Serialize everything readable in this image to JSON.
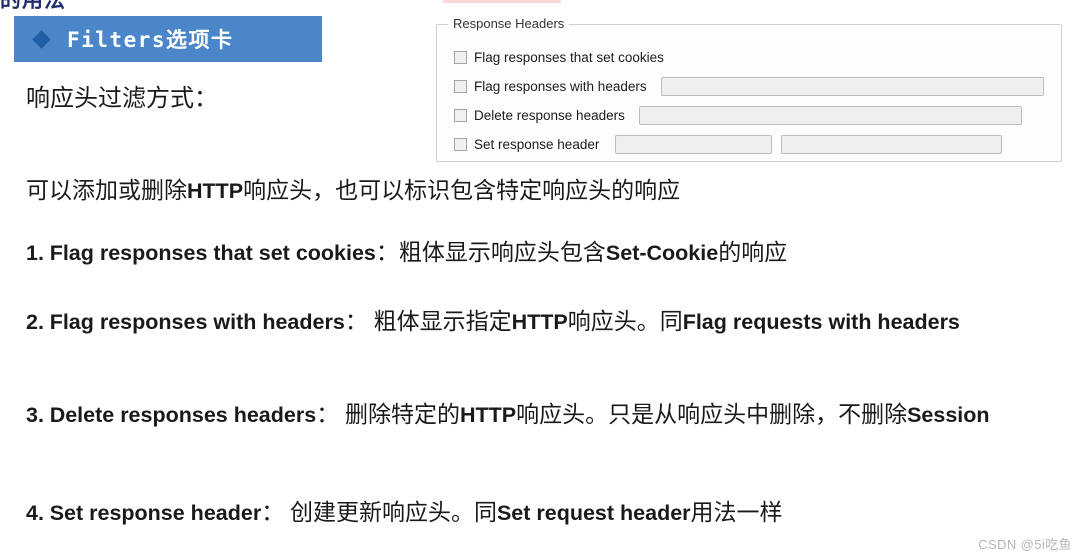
{
  "page": {
    "cutoff_title": "的用法",
    "watermark": "CSDN @5i吃鱼"
  },
  "banner": {
    "bullet_icon": "diamond-bullet-icon",
    "title": "Filters选项卡",
    "background_color": "#4a86c8",
    "bullet_color": "#1f5fa8",
    "text_color": "#ffffff"
  },
  "intro": {
    "text": "响应头过滤方式："
  },
  "fiddler_panel": {
    "groupbox_title": "Response Headers",
    "rows": [
      {
        "checkbox_label": "Flag responses that set cookies",
        "checked": false,
        "fields": []
      },
      {
        "checkbox_label": "Flag responses with headers",
        "checked": false,
        "fields": [
          {
            "value": "",
            "width": "wide"
          }
        ]
      },
      {
        "checkbox_label": "Delete response headers",
        "checked": false,
        "fields": [
          {
            "value": "",
            "width": "wide"
          }
        ]
      },
      {
        "checkbox_label": "Set response header",
        "checked": false,
        "fields": [
          {
            "value": "",
            "width": "half-a"
          },
          {
            "value": "",
            "width": "half-b"
          }
        ]
      }
    ]
  },
  "content": {
    "lead": {
      "part_a": "可以添加或删除",
      "latin_a": "HTTP",
      "part_b": "响应头，也可以标识包含特定响应头的响应"
    },
    "items": [
      {
        "number": "1.",
        "latin_title": "Flag responses that set cookies",
        "colon": "：",
        "cn_a": "粗体显示响应头包含",
        "latin_b": "Set-Cookie",
        "cn_b": "的响应"
      },
      {
        "number": "2.",
        "latin_title": "Flag responses with headers",
        "colon": "：",
        "cn_a": " 粗体显示指定",
        "latin_b": "HTTP",
        "cn_b": "响应头。同",
        "latin_c": "Flag requests with headers"
      },
      {
        "number": "3.",
        "latin_title": "Delete responses headers",
        "colon": "：",
        "cn_a": " 删除特定的",
        "latin_b": "HTTP",
        "cn_b": "响应头。只是从响应头中删除，不删除",
        "latin_c": "Session"
      },
      {
        "number": "4.",
        "latin_title": "Set response header",
        "colon": "：",
        "cn_a": " 创建更新响应头。同",
        "latin_b": "Set request header",
        "cn_b": "用法一样"
      }
    ]
  }
}
